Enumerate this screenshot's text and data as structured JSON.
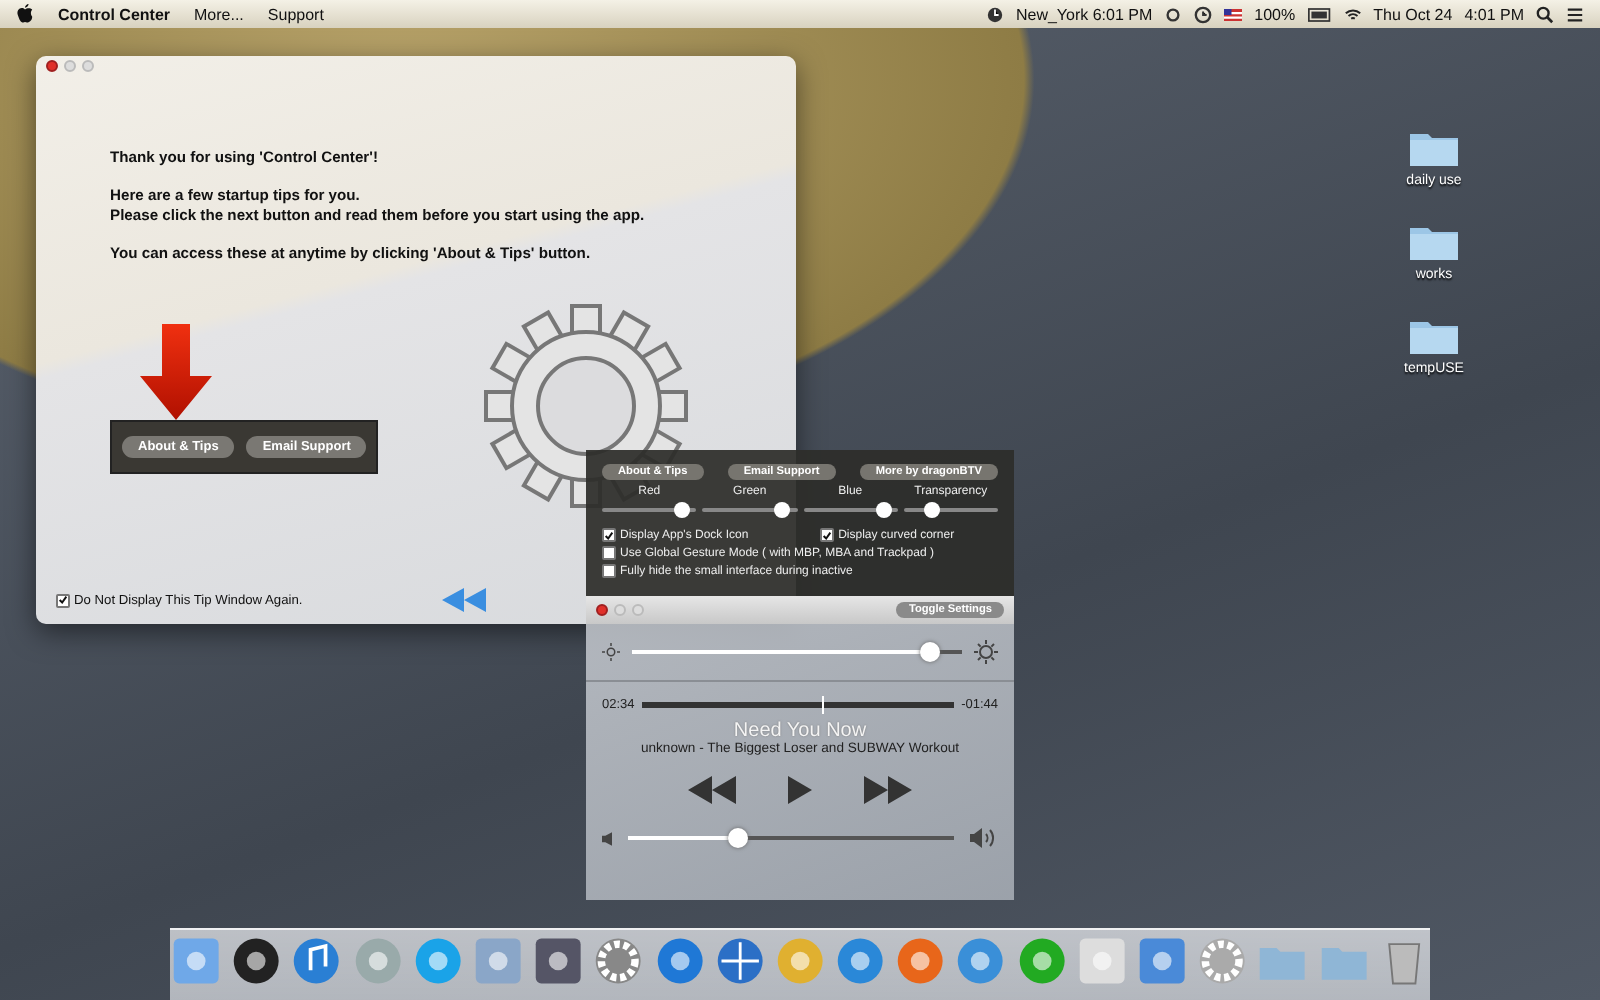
{
  "menubar": {
    "app_name": "Control Center",
    "menus": [
      "More...",
      "Support"
    ],
    "clock_city": "New_York 6:01 PM",
    "battery": "100%",
    "date": "Thu Oct 24",
    "time": "4:01 PM"
  },
  "desktop_icons": [
    {
      "label": "daily use"
    },
    {
      "label": "works"
    },
    {
      "label": "tempUSE"
    }
  ],
  "tip_window": {
    "paragraphs": [
      {
        "lines": [
          "Thank you for using 'Control Center'!"
        ]
      },
      {
        "lines": [
          "Here are a few startup tips for you.",
          "Please click the next button and read them before you start using the app."
        ]
      },
      {
        "lines": [
          "You can access these at anytime by clicking 'About & Tips' button."
        ]
      }
    ],
    "buttons": [
      "About & Tips",
      "Email Support"
    ],
    "dont_show": {
      "label": "Do Not Display This Tip Window Again.",
      "checked": true
    }
  },
  "settings_panel": {
    "buttons": [
      "About & Tips",
      "Email Support",
      "More by dragonBTV"
    ],
    "sliders": [
      {
        "label": "Red",
        "level": 0.85
      },
      {
        "label": "Green",
        "level": 0.85
      },
      {
        "label": "Blue",
        "level": 0.85
      },
      {
        "label": "Transparency",
        "level": 0.3
      }
    ],
    "options": [
      {
        "label": "Display App's Dock Icon",
        "checked": true
      },
      {
        "label": "Display curved corner",
        "checked": true
      },
      {
        "label": "Use Global Gesture Mode ( with MBP, MBA and Trackpad )",
        "checked": false
      },
      {
        "label": "Fully hide the small interface during inactive",
        "checked": false
      }
    ]
  },
  "player": {
    "toggle_button": "Toggle Settings",
    "brightness": {
      "level": 0.9
    },
    "elapsed": "02:34",
    "remaining": "-01:44",
    "progress": {
      "level": 0.58
    },
    "title": "Need You Now",
    "subtitle": "unknown - The Biggest Loser and SUBWAY Workout",
    "volume": {
      "level": 0.34
    }
  }
}
